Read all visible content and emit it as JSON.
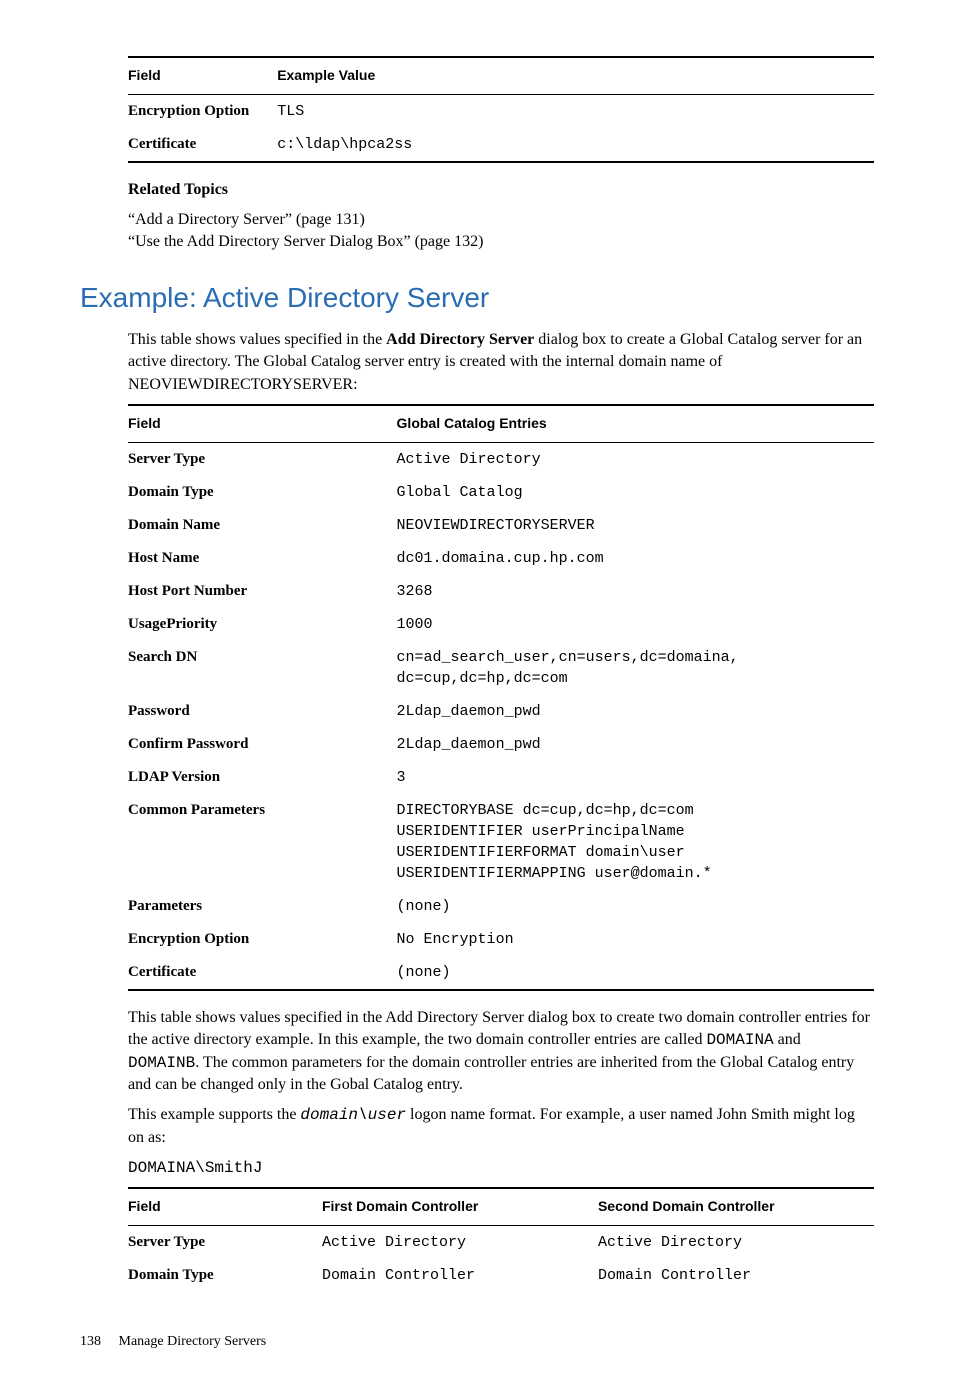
{
  "table1": {
    "headers": [
      "Field",
      "Example Value"
    ],
    "rows": [
      {
        "field": "Encryption Option",
        "value": "TLS"
      },
      {
        "field": "Certificate",
        "value": "c:\\ldap\\hpca2ss"
      }
    ]
  },
  "related": {
    "title": "Related Topics",
    "links": [
      "“Add a Directory Server” (page 131)",
      "“Use the Add Directory Server Dialog Box” (page 132)"
    ]
  },
  "section": {
    "heading": "Example: Active Directory Server",
    "intro_a": "This table shows values specified in the ",
    "intro_b_bold": "Add Directory Server",
    "intro_c": " dialog box to create a Global Catalog server for an active directory. The Global Catalog server entry is created with the internal domain name of NEOVIEWDIRECTORYSERVER:"
  },
  "table2": {
    "headers": [
      "Field",
      "Global Catalog Entries"
    ],
    "rows": [
      {
        "field": "Server Type",
        "value": "Active Directory"
      },
      {
        "field": "Domain Type",
        "value": "Global Catalog"
      },
      {
        "field": "Domain Name",
        "value": "NEOVIEWDIRECTORYSERVER"
      },
      {
        "field": "Host Name",
        "value": "dc01.domaina.cup.hp.com"
      },
      {
        "field": "Host Port Number",
        "value": "3268"
      },
      {
        "field": "UsagePriority",
        "value": "1000"
      },
      {
        "field": "Search DN",
        "value": "cn=ad_search_user,cn=users,dc=domaina,\ndc=cup,dc=hp,dc=com"
      },
      {
        "field": "Password",
        "value": "2Ldap_daemon_pwd"
      },
      {
        "field": "Confirm Password",
        "value": "2Ldap_daemon_pwd"
      },
      {
        "field": "LDAP Version",
        "value": "3"
      },
      {
        "field": "Common Parameters",
        "value": "DIRECTORYBASE dc=cup,dc=hp,dc=com\nUSERIDENTIFIER userPrincipalName\nUSERIDENTIFIERFORMAT domain\\user\nUSERIDENTIFIERMAPPING user@domain.*"
      },
      {
        "field": "Parameters",
        "value": "(none)"
      },
      {
        "field": "Encryption Option",
        "value": "No Encryption"
      },
      {
        "field": "Certificate",
        "value": "(none)"
      }
    ]
  },
  "para2_a": "This table shows values specified in the Add Directory Server dialog box to create two domain controller entries for the active directory example. In this example, the two domain controller entries are called ",
  "para2_mono1": "DOMAINA",
  "para2_b": " and ",
  "para2_mono2": "DOMAINB",
  "para2_c": ". The common parameters for the domain controller entries are inherited from the Global Catalog entry and can be changed only in the Gobal Catalog entry.",
  "para3_a": "This example supports the ",
  "para3_monoi": "domain\\user",
  "para3_b": " logon name format. For example, a user named John Smith might log on as:",
  "para4_mono": "DOMAINA\\SmithJ",
  "table3": {
    "headers": [
      "Field",
      "First Domain Controller",
      "Second Domain Controller"
    ],
    "rows": [
      {
        "field": "Server Type",
        "v1": "Active Directory",
        "v2": "Active Directory"
      },
      {
        "field": "Domain Type",
        "v1": "Domain Controller",
        "v2": "Domain Controller"
      }
    ]
  },
  "footer": {
    "page": "138",
    "label": "Manage Directory Servers"
  }
}
